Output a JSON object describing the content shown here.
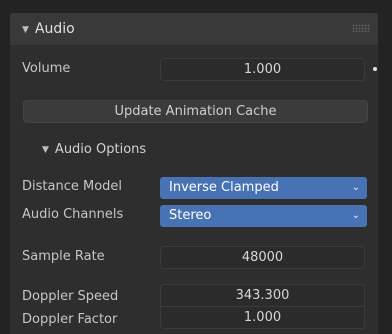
{
  "panel": {
    "title": "Audio",
    "volume_label": "Volume",
    "volume_value": "1.000",
    "update_button": "Update Animation Cache",
    "subpanel_title": "Audio Options",
    "distance_model_label": "Distance Model",
    "distance_model_value": "Inverse Clamped",
    "audio_channels_label": "Audio Channels",
    "audio_channels_value": "Stereo",
    "sample_rate_label": "Sample Rate",
    "sample_rate_value": "48000",
    "doppler_speed_label": "Doppler Speed",
    "doppler_speed_value": "343.300",
    "doppler_factor_label": "Doppler Factor",
    "doppler_factor_value": "1.000"
  },
  "icons": {
    "collapse": "triangle-down-icon",
    "grip": "drag-grip-icon",
    "dropdown": "chevron-down-icon",
    "keyframe": "dot-icon"
  },
  "colors": {
    "background": "#232323",
    "panel": "#2e2e2e",
    "header": "#393939",
    "accent": "#4772b3"
  }
}
